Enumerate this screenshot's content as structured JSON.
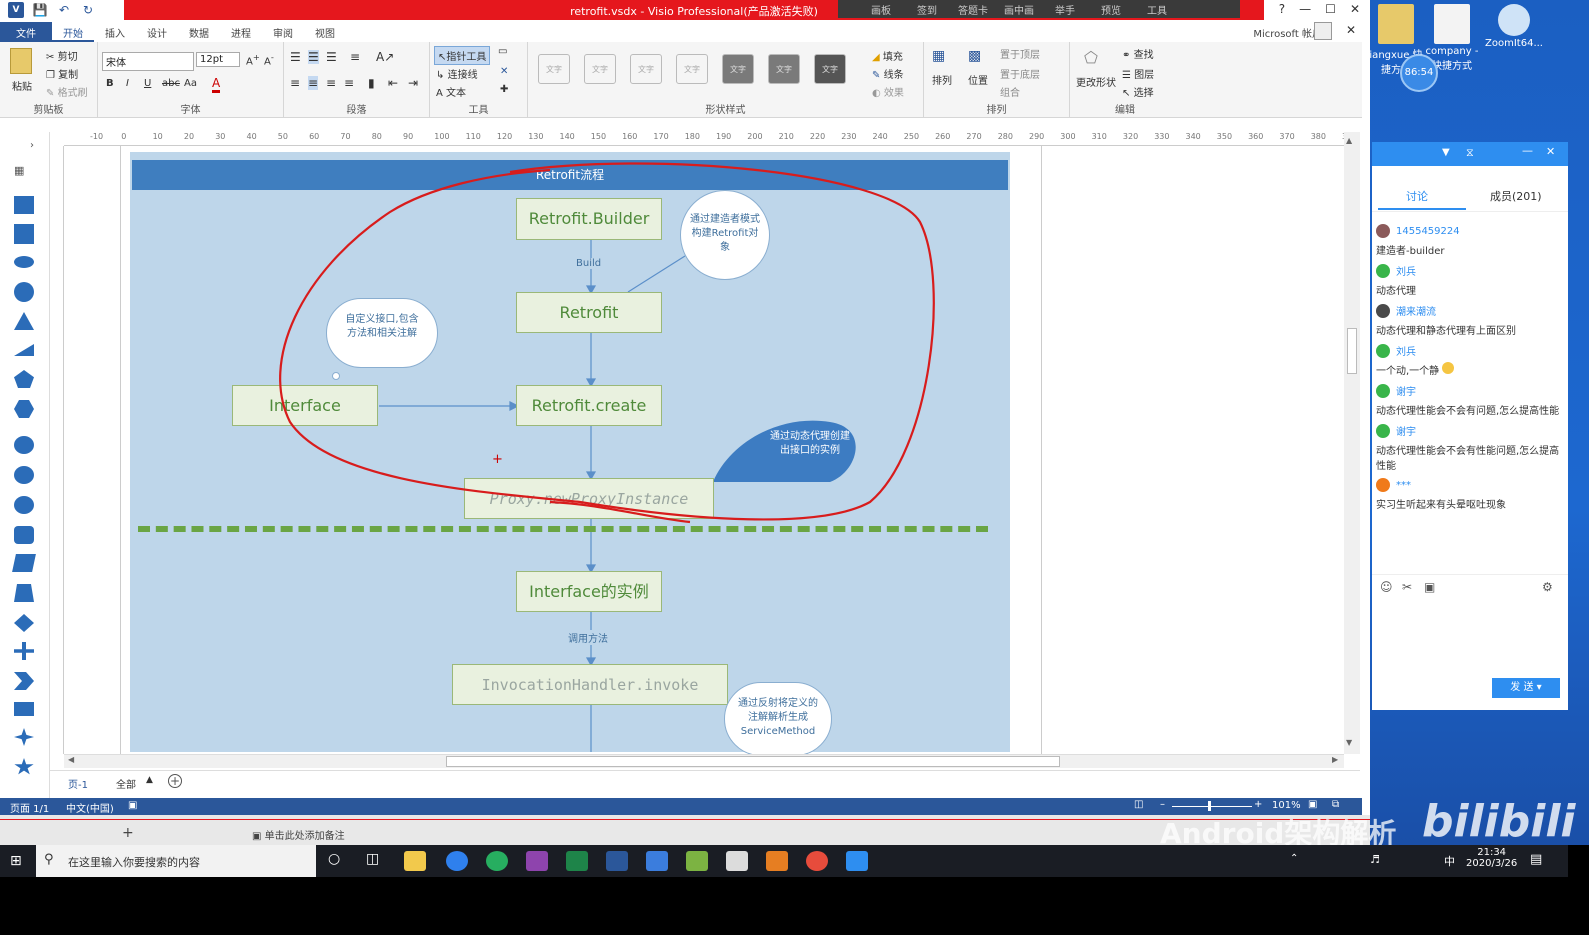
{
  "window": {
    "title": "retrofit.vsdx - Visio Professional(产品激活失败)",
    "meeting_toolbar": [
      "画板",
      "签到",
      "答题卡",
      "画中画",
      "举手",
      "预览",
      "工具"
    ],
    "account": "Microsoft 帐户",
    "help": "?"
  },
  "ribbon": {
    "tabs": [
      "文件",
      "开始",
      "插入",
      "设计",
      "数据",
      "进程",
      "审阅",
      "视图"
    ],
    "active_tab": "开始",
    "clipboard": {
      "paste": "粘贴",
      "cut": "剪切",
      "copy": "复制",
      "format_painter": "格式刷",
      "label": "剪贴板"
    },
    "font": {
      "name": "宋体",
      "size": "12pt",
      "label": "字体"
    },
    "paragraph": {
      "label": "段落"
    },
    "tools": {
      "pointer": "指针工具",
      "connector": "连接线",
      "text": "文本",
      "label": "工具"
    },
    "shape_styles": {
      "swatch_text": "文字",
      "label": "形状样式"
    },
    "fill_group": {
      "fill": "填充",
      "line": "线条",
      "effect": "效果"
    },
    "arrange": {
      "align": "排列",
      "position": "位置",
      "bring_front": "置于顶层",
      "send_back": "置于底层",
      "group": "组合",
      "label": "排列"
    },
    "change_shape": "更改形状",
    "editing": {
      "find": "查找",
      "layers": "图层",
      "select": "选择",
      "label": "编辑"
    }
  },
  "ruler_ticks": [
    "-10",
    "0",
    "10",
    "20",
    "30",
    "40",
    "50",
    "60",
    "70",
    "80",
    "90",
    "100",
    "110",
    "120",
    "130",
    "140",
    "150",
    "160",
    "170",
    "180",
    "190",
    "200",
    "210",
    "220",
    "230",
    "240",
    "250",
    "260",
    "270",
    "280",
    "290",
    "300",
    "310",
    "320",
    "330",
    "340",
    "350",
    "360",
    "370",
    "380",
    "390"
  ],
  "diagram": {
    "title": "Retrofit流程",
    "nodes": {
      "builder": "Retrofit.Builder",
      "retrofit": "Retrofit",
      "interface": "Interface",
      "create": "Retrofit.create",
      "proxy": "Proxy.newProxyInstance",
      "instance": "Interface的实例",
      "invoke": "InvocationHandler.invoke"
    },
    "edge_labels": {
      "build": "Build",
      "call_method": "调用方法"
    },
    "bubbles": {
      "builder_note": "通过建造者模式构建Retrofit对象",
      "interface_note": "自定义接口,包含方法和相关注解",
      "proxy_note": "通过动态代理创建出接口的实例",
      "invoke_note": "通过反射将定义的注解解析生成ServiceMethod"
    }
  },
  "page_tabs": {
    "page": "页-1",
    "all": "全部"
  },
  "status": {
    "page": "页面 1/1",
    "lang": "中文(中国)",
    "zoom": "101%"
  },
  "notes": "单击此处添加备注",
  "desktop_icons": [
    "iangxue 快捷方式",
    "company - 快捷方式",
    "ZoomIt64..."
  ],
  "timer": "86:54",
  "chat": {
    "tabs": [
      "讨论",
      "成员(201)"
    ],
    "messages": [
      {
        "name": "1455459224",
        "text": "建造者-builder"
      },
      {
        "name": "刘兵",
        "text": "动态代理"
      },
      {
        "name": "潮来潮流",
        "text": "动态代理和静态代理有上面区别"
      },
      {
        "name": "刘兵",
        "text": "一个动,一个静"
      },
      {
        "name": "谢宇",
        "text": "动态代理性能会不会有问题,怎么提高性能"
      },
      {
        "name": "谢宇",
        "text": "动态代理性能会不会有性能问题,怎么提高性能"
      },
      {
        "name": "***",
        "text": "实习生听起来有头晕呕吐现象"
      }
    ],
    "send": "发 送"
  },
  "taskbar": {
    "search_placeholder": "在这里输入你要搜索的内容",
    "time": "21:34",
    "date": "2020/3/26",
    "ime": "中"
  },
  "watermark": "Android架构解析",
  "watermark_brand": "bilibili"
}
